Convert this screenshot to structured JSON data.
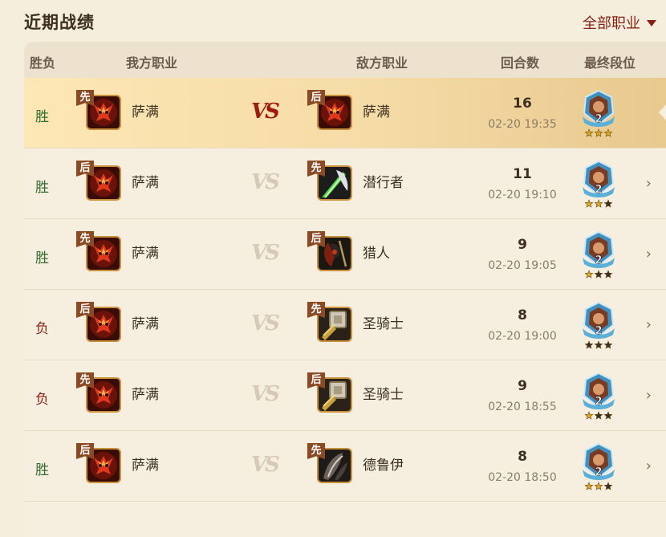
{
  "page": {
    "title": "近期战绩",
    "filter_label": "全部职业"
  },
  "table": {
    "headers": {
      "result": "胜负",
      "mine": "我方职业",
      "enemy": "敌方职业",
      "rounds": "回合数",
      "rank": "最终段位"
    },
    "vs_text": "VS",
    "rows": [
      {
        "result": "胜",
        "my_order": "先",
        "my_class": "萨满",
        "enemy_order": "后",
        "enemy_class": "萨满",
        "rounds": "16",
        "time": "02-20 19:35",
        "rank_level": "2",
        "rank_stars": 3,
        "selected": true
      },
      {
        "result": "胜",
        "my_order": "后",
        "my_class": "萨满",
        "enemy_order": "先",
        "enemy_class": "潜行者",
        "rounds": "11",
        "time": "02-20 19:10",
        "rank_level": "2",
        "rank_stars": 2,
        "selected": false
      },
      {
        "result": "胜",
        "my_order": "先",
        "my_class": "萨满",
        "enemy_order": "后",
        "enemy_class": "猎人",
        "rounds": "9",
        "time": "02-20 19:05",
        "rank_level": "2",
        "rank_stars": 1,
        "selected": false
      },
      {
        "result": "负",
        "my_order": "后",
        "my_class": "萨满",
        "enemy_order": "先",
        "enemy_class": "圣骑士",
        "rounds": "8",
        "time": "02-20 19:00",
        "rank_level": "2",
        "rank_stars": 0,
        "selected": false
      },
      {
        "result": "负",
        "my_order": "先",
        "my_class": "萨满",
        "enemy_order": "后",
        "enemy_class": "圣骑士",
        "rounds": "9",
        "time": "02-20 18:55",
        "rank_level": "2",
        "rank_stars": 1,
        "selected": false
      },
      {
        "result": "胜",
        "my_order": "后",
        "my_class": "萨满",
        "enemy_order": "先",
        "enemy_class": "德鲁伊",
        "rounds": "8",
        "time": "02-20 18:50",
        "rank_level": "2",
        "rank_stars": 2,
        "selected": false
      }
    ]
  },
  "colors": {
    "win": "#2f6e2f",
    "lose": "#8a1f13",
    "accent": "#8a1f13",
    "star_on": "#d9a520",
    "star_off": "#3b2f26"
  },
  "icons": {
    "shaman": "shaman-class-icon",
    "rogue": "rogue-class-icon",
    "hunter": "hunter-class-icon",
    "paladin": "paladin-class-icon",
    "druid": "druid-class-icon",
    "rank": "rank-badge-icon",
    "chevron": "chevron-right-icon",
    "caret": "caret-down-icon"
  }
}
